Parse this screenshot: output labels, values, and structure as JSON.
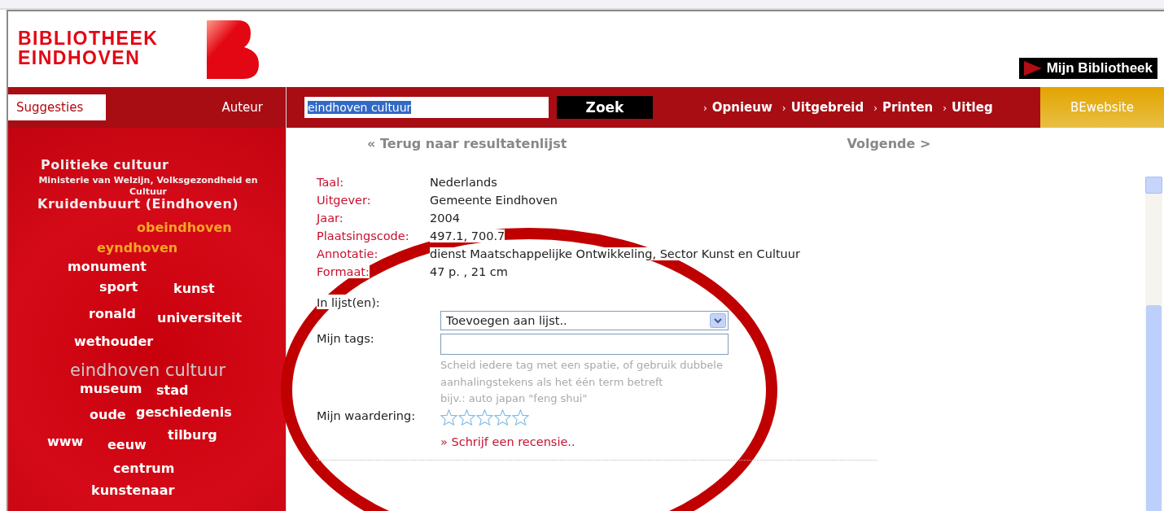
{
  "logo": {
    "line_1": "BIBLIOTHEEK",
    "line_2": "EINDHOVEN"
  },
  "account_button": {
    "label": "Mijn Bibliotheek"
  },
  "sidebar": {
    "tabs": [
      {
        "label": "Suggesties",
        "selected": true
      },
      {
        "label": "Auteur",
        "selected": false
      }
    ],
    "cloud": [
      {
        "text": "Politieke cultuur",
        "kind": "large"
      },
      {
        "text": "Ministerie van Welzijn, Volksgezondheid en Cultuur",
        "kind": "small"
      },
      {
        "text": "Kruidenbuurt (Eindhoven)",
        "kind": "large"
      },
      {
        "text": "obeindhoven",
        "kind": "orange"
      },
      {
        "text": "eyndhoven",
        "kind": "orange"
      },
      {
        "text": "monument",
        "kind": "word"
      },
      {
        "text": "sport",
        "kind": "word"
      },
      {
        "text": "kunst",
        "kind": "word"
      },
      {
        "text": "ronald",
        "kind": "word"
      },
      {
        "text": "universiteit",
        "kind": "word"
      },
      {
        "text": "wethouder",
        "kind": "word"
      },
      {
        "text": "eindhoven cultuur",
        "kind": "query"
      },
      {
        "text": "museum",
        "kind": "word"
      },
      {
        "text": "stad",
        "kind": "word"
      },
      {
        "text": "oude",
        "kind": "word"
      },
      {
        "text": "geschiedenis",
        "kind": "word"
      },
      {
        "text": "tilburg",
        "kind": "word"
      },
      {
        "text": "www",
        "kind": "word"
      },
      {
        "text": "eeuw",
        "kind": "word"
      },
      {
        "text": "centrum",
        "kind": "word"
      },
      {
        "text": "kunstenaar",
        "kind": "word"
      }
    ]
  },
  "search": {
    "value": "eindhoven cultuur",
    "button": "Zoek"
  },
  "nav_links": [
    {
      "arrow": "›",
      "label": "Opnieuw"
    },
    {
      "arrow": "›",
      "label": "Uitgebreid"
    },
    {
      "arrow": "›",
      "label": "Printen"
    },
    {
      "arrow": "›",
      "label": "Uitleg"
    }
  ],
  "site_button": {
    "label": "BEwebsite"
  },
  "back_link": "« Terug naar resultatenlijst",
  "next_link": "Volgende >",
  "details": [
    {
      "label": "Taal:",
      "value": "Nederlands"
    },
    {
      "label": "Uitgever:",
      "value": "Gemeente Eindhoven"
    },
    {
      "label": "Jaar:",
      "value": "2004"
    },
    {
      "label": "Plaatsingscode:",
      "value": "497.1, 700.7"
    },
    {
      "label": "Annotatie:",
      "value": "dienst Maatschappelijke Ontwikkeling, Sector Kunst en Cultuur"
    },
    {
      "label": "Formaat:",
      "value": "47 p. , 21 cm"
    }
  ],
  "lists": {
    "label": "In lijst(en):",
    "dropdown": "Toevoegen aan lijst.."
  },
  "tags": {
    "label": "Mijn tags:",
    "hint": "Scheid iedere tag met een spatie, of gebruik dubbele aanhalingstekens als het één term betreft",
    "example": "bijv.: auto japan \"feng shui\""
  },
  "rating": {
    "label": "Mijn waardering:",
    "stars": 0
  },
  "review_link": {
    "arrow": "»",
    "label": "Schrijf een recensie.."
  }
}
